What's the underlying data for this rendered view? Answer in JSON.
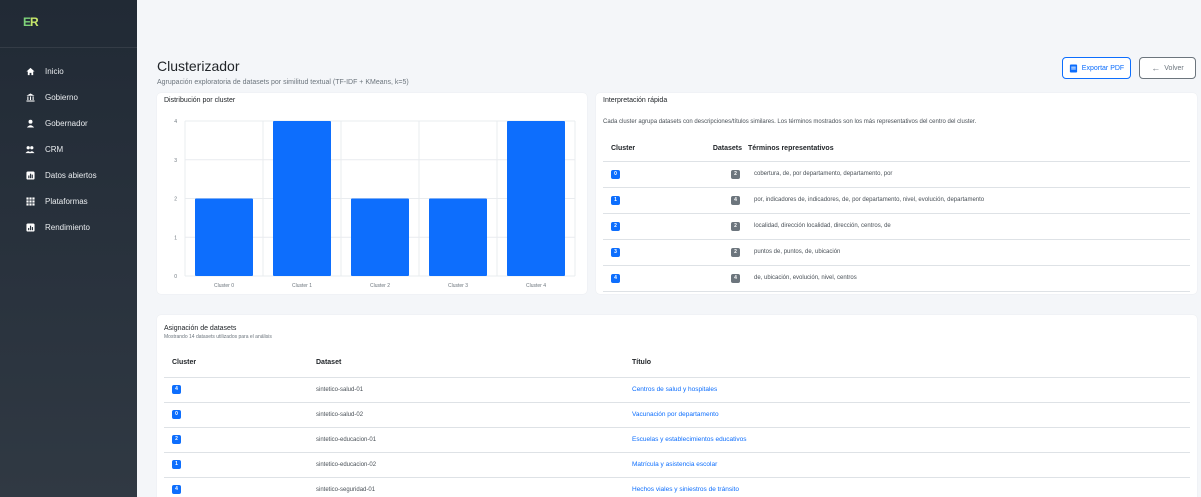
{
  "app": {
    "logo_e": "E",
    "logo_r": "R"
  },
  "sidebar": {
    "items": [
      {
        "label": "Inicio",
        "icon": "home-icon"
      },
      {
        "label": "Gobierno",
        "icon": "bank-icon"
      },
      {
        "label": "Gobernador",
        "icon": "person-icon"
      },
      {
        "label": "CRM",
        "icon": "people-icon"
      },
      {
        "label": "Datos abiertos",
        "icon": "dataset-icon"
      },
      {
        "label": "Plataformas",
        "icon": "grid-icon"
      },
      {
        "label": "Rendimiento",
        "icon": "chart-icon"
      }
    ]
  },
  "header": {
    "title": "Clusterizador",
    "subtitle": "Agrupación exploratoria de datasets por similitud textual (TF-IDF + KMeans, k=5)",
    "export_label": "Exportar PDF",
    "back_label": "Volver"
  },
  "chart_card": {
    "title": "Distribución por cluster"
  },
  "chart_data": {
    "type": "bar",
    "categories": [
      "Cluster 0",
      "Cluster 1",
      "Cluster 2",
      "Cluster 3",
      "Cluster 4"
    ],
    "values": [
      2,
      4,
      2,
      2,
      4
    ],
    "ylim": [
      0,
      4
    ],
    "yticks": [
      "0",
      "1",
      "2",
      "3",
      "4"
    ],
    "color": "#0d6efd",
    "grid": true,
    "legend": false,
    "title": "",
    "xlabel": "",
    "ylabel": ""
  },
  "interpretation": {
    "title": "Interpretación rápida",
    "description": "Cada cluster agrupa datasets con descripciones/títulos similares. Los términos mostrados son los más representativos del centro del cluster.",
    "headers": {
      "cluster": "Cluster",
      "datasets": "Datasets",
      "terms": "Términos representativos"
    },
    "rows": [
      {
        "cluster": "0",
        "datasets": "2",
        "terms": "cobertura, de, por departamento, departamento, por"
      },
      {
        "cluster": "1",
        "datasets": "4",
        "terms": "por, indicadores de, indicadores, de, por departamento, nivel, evolución, departamento"
      },
      {
        "cluster": "2",
        "datasets": "2",
        "terms": "localidad, dirección localidad, dirección, centros, de"
      },
      {
        "cluster": "3",
        "datasets": "2",
        "terms": "puntos de, puntos, de, ubicación"
      },
      {
        "cluster": "4",
        "datasets": "4",
        "terms": "de, ubicación, evolución, nivel, centros"
      }
    ]
  },
  "assignments": {
    "title": "Asignación de datasets",
    "subtitle": "Mostrando 14 datasets utilizados para el análisis",
    "headers": {
      "cluster": "Cluster",
      "dataset": "Dataset",
      "titulo": "Título"
    },
    "rows": [
      {
        "cluster": "4",
        "dataset": "sintetico-salud-01",
        "titulo": "Centros de salud y hospitales"
      },
      {
        "cluster": "0",
        "dataset": "sintetico-salud-02",
        "titulo": "Vacunación por departamento"
      },
      {
        "cluster": "2",
        "dataset": "sintetico-educacion-01",
        "titulo": "Escuelas y establecimientos educativos"
      },
      {
        "cluster": "1",
        "dataset": "sintetico-educacion-02",
        "titulo": "Matrícula y asistencia escolar"
      },
      {
        "cluster": "4",
        "dataset": "sintetico-seguridad-01",
        "titulo": "Hechos viales y siniestros de tránsito"
      }
    ]
  }
}
